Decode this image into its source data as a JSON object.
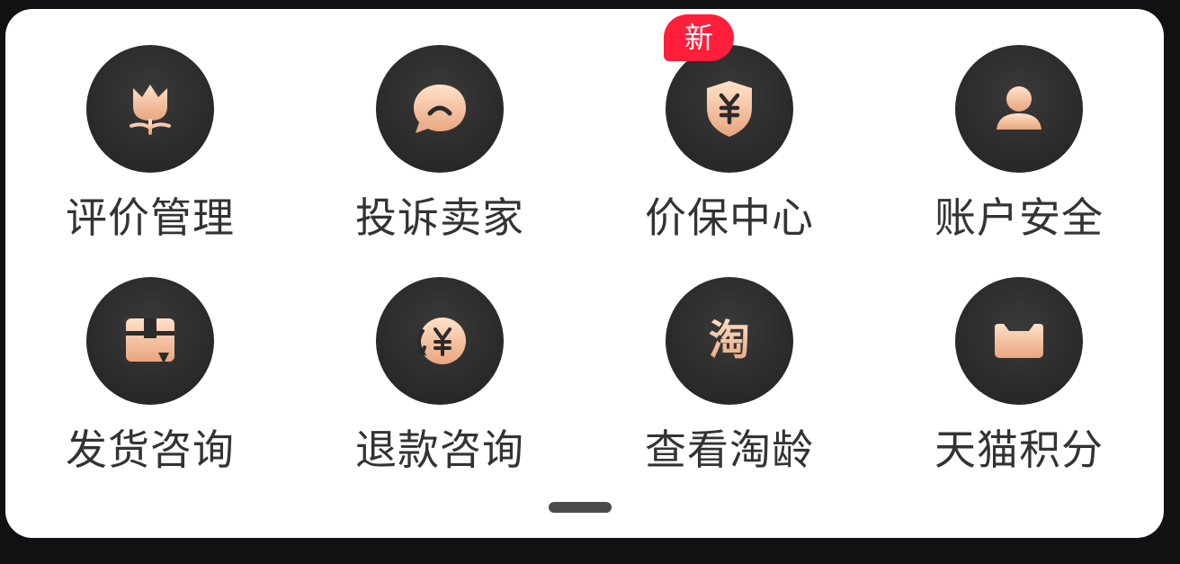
{
  "menu": {
    "items": [
      {
        "label": "评价管理",
        "icon": "tulip-icon"
      },
      {
        "label": "投诉卖家",
        "icon": "speech-bubble-icon"
      },
      {
        "label": "价保中心",
        "icon": "yen-shield-icon",
        "badge": "新"
      },
      {
        "label": "账户安全",
        "icon": "user-icon"
      },
      {
        "label": "发货咨询",
        "icon": "package-icon"
      },
      {
        "label": "退款咨询",
        "icon": "yen-refund-icon"
      },
      {
        "label": "查看淘龄",
        "icon": "tao-icon",
        "glyph": "淘"
      },
      {
        "label": "天猫积分",
        "icon": "tmall-icon"
      }
    ]
  },
  "colors": {
    "icon_bg": "#2b2b2b",
    "icon_accent": "#f5c9a6",
    "badge_bg": "#ff1f3a",
    "label": "#333333"
  },
  "pager": {
    "pages": 2,
    "current": 1
  }
}
